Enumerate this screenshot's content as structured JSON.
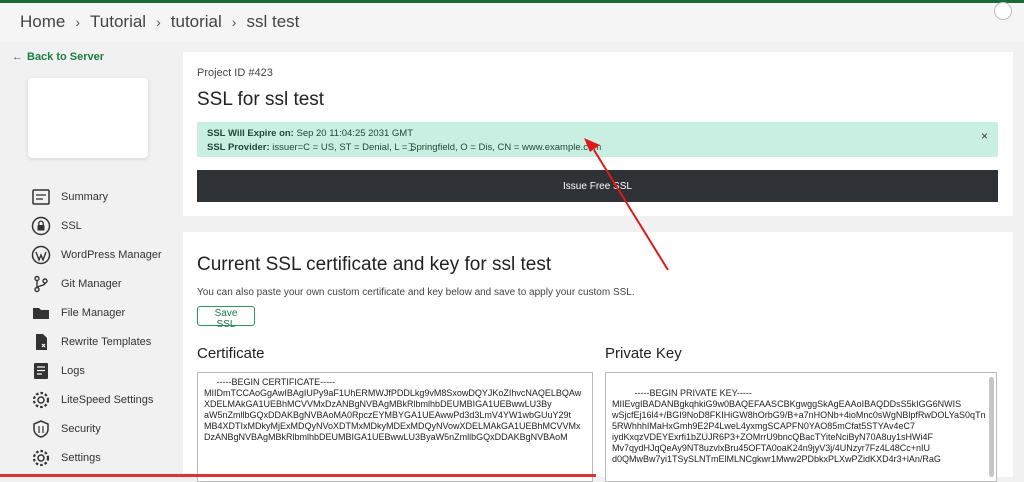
{
  "breadcrumb": [
    "Home",
    "Tutorial",
    "tutorial",
    "ssl test"
  ],
  "sidebar": {
    "back_label": "Back to Server",
    "items": [
      {
        "label": "Summary",
        "icon": "summary-icon"
      },
      {
        "label": "SSL",
        "icon": "lock-icon"
      },
      {
        "label": "WordPress Manager",
        "icon": "wordpress-icon"
      },
      {
        "label": "Git Manager",
        "icon": "git-icon"
      },
      {
        "label": "File Manager",
        "icon": "folder-icon"
      },
      {
        "label": "Rewrite Templates",
        "icon": "file-icon"
      },
      {
        "label": "Logs",
        "icon": "logs-icon"
      },
      {
        "label": "LiteSpeed Settings",
        "icon": "gear-icon"
      },
      {
        "label": "Security",
        "icon": "shield-icon"
      },
      {
        "label": "Settings",
        "icon": "gear-icon"
      }
    ]
  },
  "ssl_card": {
    "project_id": "Project ID #423",
    "title": "SSL for ssl test",
    "expire_label": "SSL Will Expire on:",
    "expire_value": " Sep 20 11:04:25 2031 GMT",
    "provider_label": "SSL Provider:",
    "provider_value": " issuer=C = US, ST = Denial, L = Springfield, O = Dis, CN = www.example.com",
    "close_symbol": "×",
    "issue_button": "Issue Free SSL"
  },
  "cert_card": {
    "title": "Current SSL certificate and key for ssl test",
    "description": "You can also paste your own custom certificate and key below and save to apply your custom SSL.",
    "save_button": "Save SSL",
    "certificate_label": "Certificate",
    "private_key_label": "Private Key",
    "certificate_text": "     -----BEGIN CERTIFICATE-----\nMIIDmTCCAoGgAwIBAgIUPy9aF1UhERMWJfPDDLkg9vM8SxowDQYJKoZIhvcNAQELBQAwXDELMAkGA1UEBhMCVVMxDzANBgNVBAgMBkRlbmlhbDEUMBIGA1UEBwwLU3By\naW5nZmllbGQxDDAKBgNVBAoMA0RpczEYMBYGA1UEAwwPd3d3LmV4YW1wbGUuY29t\nMB4XDTIxMDkyMjExMDQyNVoXDTMxMDkyMDExMDQyNVowXDELMAkGA1UEBhMCVVMx\nDzANBgNVBAgMBkRlbmlhbDEUMBIGA1UEBwwLU3ByaW5nZmllbGQxDDAKBgNVBAoM",
    "private_key_text": "     -----BEGIN PRIVATE KEY-----\nMIIEvgIBADANBgkqhkiG9w0BAQEFAASCBKgwggSkAgEAAoIBAQDDsS5kIGG6NWIS\nwSjcfEj16l4+/BGI9NoD8FKIHiGW8hOrbG9/B+a7nHONb+4ioMnc0sWgNBlpfRwDOLYaS0qTn5RWhhhIMaHxGmh9E2P4LweL4yxmgSCAPFN0YAO85mCfat5STYAv4eC7\niydKxqzVDEYExrfi1bZUJR6P3+ZOMrrU9bncQBacTYiteNciByN70A8uy1sHWi4F\nMv7qydHJqQeAy9NT8uzvlxBru45OFTA0oaK24n9jyV3j/4UNzyr7Fz4L48Cc+nIU\nd0QMwBw7yi1TSySLNTmElMLNCgkwr1Mww2PDbkxPLXwPZidKXD4r3+lAn/RaG"
  }
}
